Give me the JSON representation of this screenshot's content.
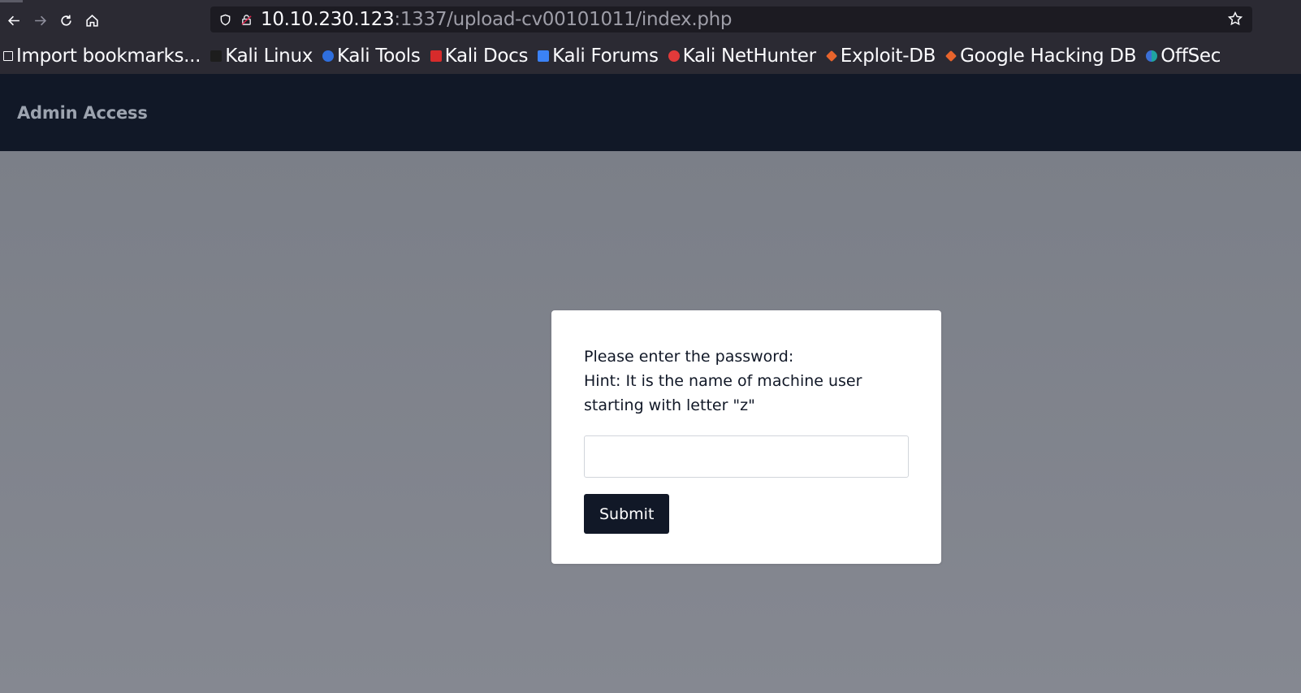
{
  "browser": {
    "url_host": "10.10.230.123",
    "url_path": ":1337/upload-cv00101011/index.php",
    "bookmarks": [
      {
        "label": "Import bookmarks...",
        "icon": "import-icon"
      },
      {
        "label": "Kali Linux",
        "icon": "kali-linux-icon"
      },
      {
        "label": "Kali Tools",
        "icon": "kali-tools-icon"
      },
      {
        "label": "Kali Docs",
        "icon": "kali-docs-icon"
      },
      {
        "label": "Kali Forums",
        "icon": "kali-forums-icon"
      },
      {
        "label": "Kali NetHunter",
        "icon": "kali-nethunter-icon"
      },
      {
        "label": "Exploit-DB",
        "icon": "exploit-db-icon"
      },
      {
        "label": "Google Hacking DB",
        "icon": "ghdb-icon"
      },
      {
        "label": "OffSec",
        "icon": "offsec-icon"
      }
    ]
  },
  "header": {
    "title": "Admin Access"
  },
  "form": {
    "prompt_line1": "Please enter the password:",
    "prompt_line2": "Hint: It is the name of machine user starting with letter \"z\"",
    "password_value": "",
    "submit_label": "Submit"
  },
  "colors": {
    "header_bg": "#111827",
    "page_bg": "#7d818a",
    "card_bg": "#ffffff",
    "button_bg": "#111827"
  }
}
